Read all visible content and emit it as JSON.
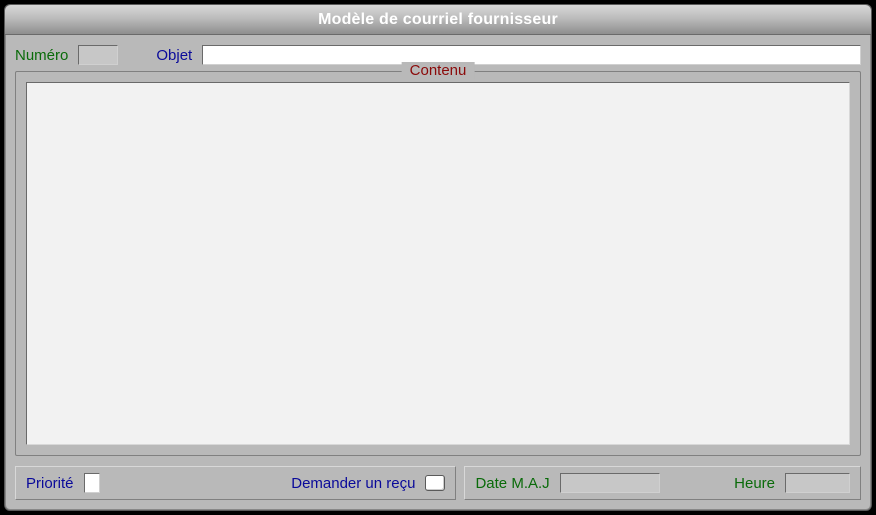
{
  "window": {
    "title": "Modèle de courriel fournisseur"
  },
  "top": {
    "number_label": "Numéro",
    "number_value": "",
    "subject_label": "Objet",
    "subject_value": ""
  },
  "content": {
    "legend": "Contenu",
    "value": ""
  },
  "bottom": {
    "priority_label": "Priorité",
    "priority_value": "",
    "receipt_label": "Demander un reçu",
    "receipt_checked": false,
    "date_label": "Date M.A.J",
    "date_value": "",
    "time_label": "Heure",
    "time_value": ""
  }
}
